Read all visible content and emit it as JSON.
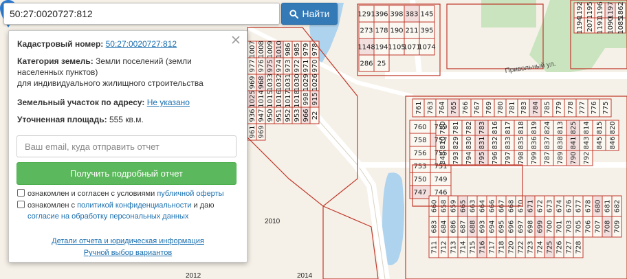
{
  "search": {
    "value": "50:27:0020727:812",
    "button_label": "Найти"
  },
  "panel": {
    "cadastral_label": "Кадастровый номер:",
    "cadastral_value": "50:27:0020727:812",
    "category_label": "Категория земель:",
    "category_value": "Земли поселений (земли населенных пунктов)",
    "category_use": "для индивидуального жилищного строительства",
    "address_label": "Земельный участок по адресу:",
    "address_value": "Не указано",
    "area_label": "Уточненная площадь:",
    "area_value": "555 кв.м.",
    "email_placeholder": "Ваш email, куда отправить отчет",
    "report_button": "Получить подробный отчет",
    "consent1_text": "ознакомлен и согласен с условиями",
    "consent1_link": "публичной оферты",
    "consent2_text": "ознакомлен с",
    "consent2_link": "политикой конфиденциальности",
    "consent2_and": "и даю",
    "consent2_link2": "согласие на обработку персональных данных",
    "details_link": "Детали отчета и юридическая информация",
    "manual_link": "Ручной выбор вариантов"
  },
  "map": {
    "street_label": "Привольный ул.",
    "area_labels": [
      "2010",
      "2012",
      "2014"
    ],
    "parcel_numbers": {
      "top_center": [
        "1291",
        "396",
        "398",
        "383",
        "145",
        "273",
        "178",
        "190",
        "211",
        "395",
        "1148",
        "194",
        "1105",
        "1071",
        "1074",
        "286",
        "25"
      ],
      "top_right": [
        "1192",
        "1195",
        "1196",
        "1197",
        "1862",
        "1194",
        "207",
        "1191",
        "1090",
        "1085"
      ],
      "left_block": [
        "1007",
        "1008",
        "1009",
        "1010",
        "986",
        "985",
        "979",
        "978",
        "977",
        "976",
        "975",
        "974",
        "973",
        "972",
        "971",
        "970",
        "969",
        "968",
        "1033",
        "1032",
        "1031",
        "1030",
        "1029",
        "1026",
        "1025",
        "1014",
        "1015",
        "1016",
        "1017",
        "1018",
        "998",
        "915",
        "936",
        "947",
        "950",
        "951",
        "952",
        "953",
        "966",
        "22",
        "961",
        "969"
      ],
      "right_block_row1": [
        "761",
        "763",
        "764",
        "765",
        "766",
        "767",
        "769",
        "780",
        "781",
        "783",
        "784",
        "785",
        "779",
        "778",
        "777",
        "776",
        "775"
      ],
      "right_block_row2": [
        "760",
        "759",
        "758",
        "757",
        "756",
        "755",
        "753",
        "751",
        "750",
        "749",
        "747",
        "746"
      ],
      "right_block_main": [
        "780",
        "781",
        "782",
        "783",
        "816",
        "817",
        "818",
        "819",
        "824",
        "813",
        "825",
        "814",
        "815",
        "820",
        "810",
        "829",
        "830",
        "831",
        "832",
        "833",
        "835",
        "836",
        "837",
        "838",
        "841",
        "843",
        "845",
        "846",
        "848",
        "793",
        "794",
        "795",
        "796",
        "797",
        "798",
        "799",
        "787",
        "789",
        "790",
        "792"
      ],
      "right_block_lower": [
        "660",
        "658",
        "659",
        "665",
        "663",
        "664",
        "666",
        "667",
        "668",
        "670",
        "671",
        "672",
        "673",
        "674",
        "676",
        "677",
        "678",
        "680",
        "681",
        "682",
        "683",
        "684",
        "686",
        "687",
        "688",
        "693",
        "694",
        "695",
        "696",
        "697",
        "698",
        "699",
        "700",
        "701",
        "703",
        "705",
        "706",
        "707",
        "708",
        "709",
        "711",
        "712",
        "713",
        "714",
        "715",
        "716",
        "717",
        "718",
        "720",
        "722",
        "723",
        "724",
        "725",
        "726",
        "727",
        "728"
      ]
    }
  }
}
